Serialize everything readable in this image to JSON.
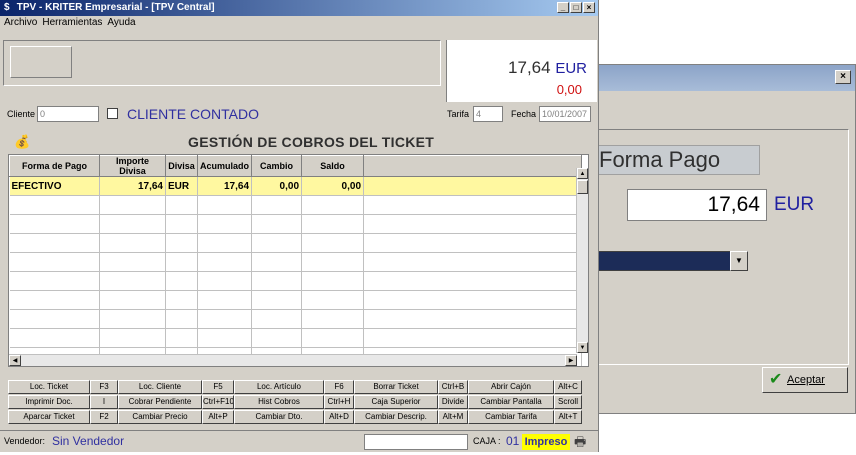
{
  "dialog": {
    "forma_pago_label": "Forma Pago",
    "amount": "17,64",
    "currency": "EUR",
    "ok_button": "Aceptar",
    "close": "×"
  },
  "window": {
    "title": "TPV - KRITER Empresarial - [TPV Central]",
    "menu": [
      "Archivo",
      "Herramientas",
      "Ayuda"
    ]
  },
  "totals": {
    "amount": "17,64",
    "currency": "EUR",
    "change": "0,00"
  },
  "client": {
    "label": "Cliente",
    "value": "0",
    "name": "CLIENTE CONTADO",
    "tarifa_label": "Tarifa",
    "tarifa_value": "4",
    "fecha_label": "Fecha",
    "fecha_value": "10/01/2007"
  },
  "section": {
    "title": "GESTIÓN DE COBROS DEL TICKET"
  },
  "grid": {
    "columns": [
      "Forma de Pago",
      "Importe Divisa",
      "Divisa",
      "Acumulado",
      "Cambio",
      "Saldo"
    ],
    "rows": [
      [
        "EFECTIVO",
        "17,64",
        "EUR",
        "17,64",
        "0,00",
        "0,00"
      ]
    ]
  },
  "keys": [
    [
      "Loc. Ticket",
      "F3",
      "Loc. Cliente",
      "F5",
      "Loc. Artículo",
      "F6",
      "Borrar Ticket",
      "Ctrl+B",
      "Abrir Cajón",
      "Alt+C"
    ],
    [
      "Imprimir Doc.",
      "I",
      "Cobrar Pendiente",
      "Ctrl+F10",
      "Hist Cobros",
      "Ctrl+H",
      "Caja Superior",
      "Divide",
      "Cambiar Pantalla",
      "Scroll"
    ],
    [
      "Aparcar Ticket",
      "F2",
      "Cambiar Precio",
      "Alt+P",
      "Cambiar Dto.",
      "Alt+D",
      "Cambiar Descrip.",
      "Alt+M",
      "Cambiar Tarifa",
      "Alt+T"
    ]
  ],
  "status": {
    "vendedor_label": "Vendedor:",
    "vendedor_name": "Sin Vendedor",
    "caja_label": "CAJA :",
    "caja_num": "01",
    "impreso": "Impreso"
  },
  "colors": {
    "title_bar": "#0a246a",
    "highlight_row": "#fff8a0",
    "change_red": "#d01010",
    "client_blue": "#3030a0",
    "impreso_bg": "#ffff00"
  }
}
